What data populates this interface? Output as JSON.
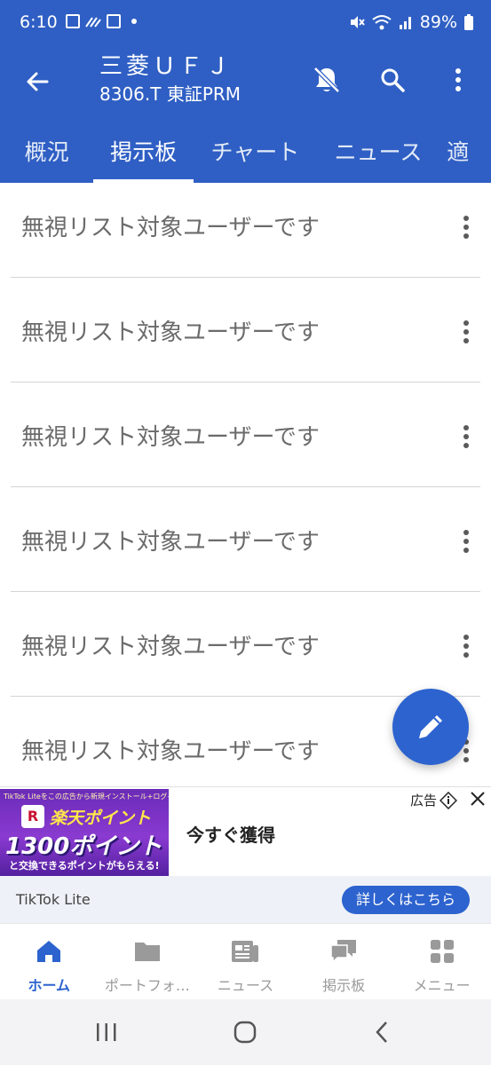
{
  "status_bar": {
    "time": "6:10",
    "battery": "89%"
  },
  "header": {
    "title": "三菱ＵＦＪ",
    "subtitle": "8306.T 東証PRM"
  },
  "tabs": [
    {
      "label": "概況"
    },
    {
      "label": "掲示板",
      "active": true
    },
    {
      "label": "チャート"
    },
    {
      "label": "ニュース"
    },
    {
      "label": "適"
    }
  ],
  "list": {
    "items": [
      {
        "text": "無視リスト対象ユーザーです"
      },
      {
        "text": "無視リスト対象ユーザーです"
      },
      {
        "text": "無視リスト対象ユーザーです"
      },
      {
        "text": "無視リスト対象ユーザーです"
      },
      {
        "text": "無視リスト対象ユーザーです"
      },
      {
        "text": "無視リスト対象ユーザーです"
      }
    ]
  },
  "ad": {
    "image_top_text": "TikTok Liteをこの広告から新規インストール+ログインで",
    "image_logo": "R",
    "image_brand": "楽天ポイント",
    "image_points": "1300ポイント",
    "image_bottom_text": "と交換できるポイントがもらえる!",
    "headline": "今すぐ獲得",
    "label": "広告",
    "advertiser": "TikTok Lite",
    "cta": "詳しくはこちら"
  },
  "bottom_nav": [
    {
      "label": "ホーム",
      "icon": "home-icon",
      "active": true
    },
    {
      "label": "ポートフォ…",
      "icon": "folder-icon"
    },
    {
      "label": "ニュース",
      "icon": "news-icon"
    },
    {
      "label": "掲示板",
      "icon": "chat-icon"
    },
    {
      "label": "メニュー",
      "icon": "grid-menu-icon"
    }
  ],
  "colors": {
    "primary": "#2f5fc4",
    "accent": "#2d63cf",
    "list_text": "#6b6b6b"
  }
}
